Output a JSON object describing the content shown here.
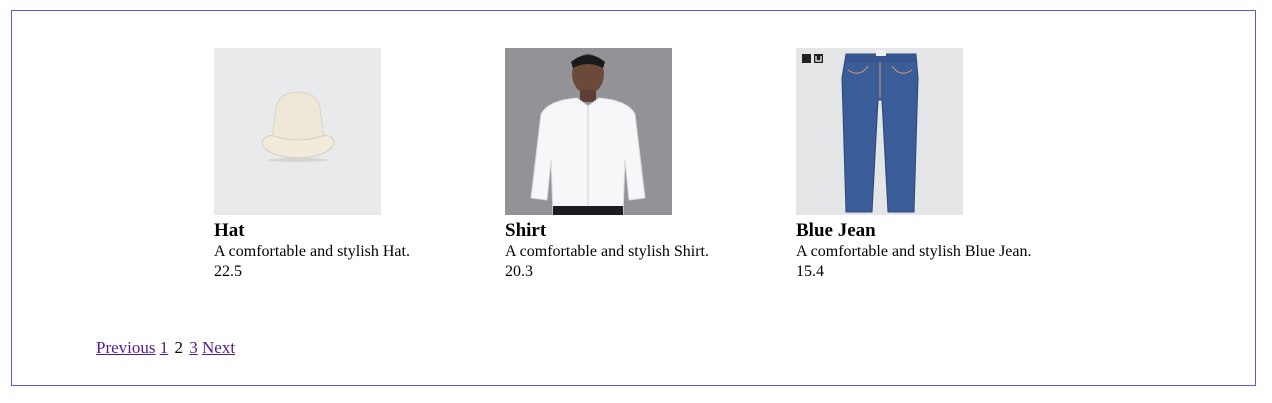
{
  "products": [
    {
      "name": "Hat",
      "description": "A comfortable and stylish Hat.",
      "price": "22.5",
      "image": "hat-photo"
    },
    {
      "name": "Shirt",
      "description": "A comfortable and stylish Shirt.",
      "price": "20.3",
      "image": "shirt-photo"
    },
    {
      "name": "Blue Jean",
      "description": "A comfortable and stylish Blue Jean.",
      "price": "15.4",
      "image": "jeans-photo"
    }
  ],
  "pagination": {
    "previous": "Previous",
    "pages": [
      "1",
      "2",
      "3"
    ],
    "current": "2",
    "next": "Next"
  },
  "colors": {
    "border": "#5b5bd6",
    "link": "#551a8b"
  }
}
